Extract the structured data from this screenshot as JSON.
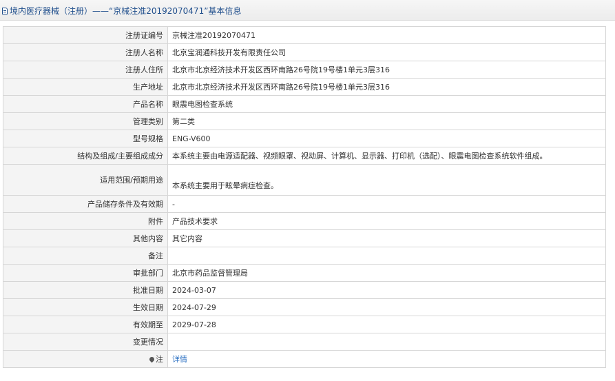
{
  "header": {
    "title": "境内医疗器械（注册）——“京械注准20192070471”基本信息",
    "icon": "document-icon"
  },
  "rows": [
    {
      "label": "注册证编号",
      "value": "京械注准20192070471"
    },
    {
      "label": "注册人名称",
      "value": "北京宝润通科技开发有限责任公司"
    },
    {
      "label": "注册人住所",
      "value": "北京市北京经济技术开发区西环南路26号院19号楼1单元3层316"
    },
    {
      "label": "生产地址",
      "value": "北京市北京经济技术开发区西环南路26号院19号楼1单元3层316"
    },
    {
      "label": "产品名称",
      "value": "眼震电图检查系统"
    },
    {
      "label": "管理类别",
      "value": "第二类"
    },
    {
      "label": "型号规格",
      "value": "ENG-V600"
    },
    {
      "label": "结构及组成/主要组成成分",
      "value": "本系统主要由电源适配器、视频眼罩、视动屏、计算机、显示器、打印机（选配）、眼震电图检查系统软件组成。"
    },
    {
      "label": "适用范围/预期用途",
      "value": "本系统主要用于眩晕病症检查。"
    },
    {
      "label": "产品储存条件及有效期",
      "value": "-"
    },
    {
      "label": "附件",
      "value": "产品技术要求"
    },
    {
      "label": "其他内容",
      "value": "其它内容"
    },
    {
      "label": "备注",
      "value": ""
    },
    {
      "label": "审批部门",
      "value": "北京市药品监督管理局"
    },
    {
      "label": "批准日期",
      "value": "2024-03-07"
    },
    {
      "label": "生效日期",
      "value": "2024-07-29"
    },
    {
      "label": "有效期至",
      "value": "2029-07-28"
    },
    {
      "label": "变更情况",
      "value": ""
    },
    {
      "label": "注",
      "value": "详情",
      "icon": "location-pin-icon"
    }
  ],
  "colors": {
    "header_text": "#1f4e8c",
    "link": "#2a6fc2",
    "label_bg": "#f4f4f4",
    "border": "#d6d6d6"
  }
}
